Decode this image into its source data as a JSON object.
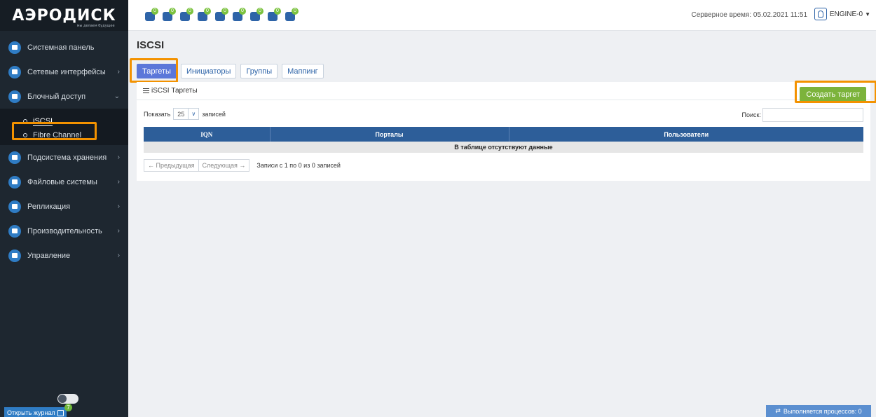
{
  "app": {
    "logo": "АЭРОДИСК",
    "logo_tagline": "мы делаем будущее"
  },
  "sidebar": {
    "items": [
      {
        "label": "Системная панель",
        "icon": "dashboard-icon",
        "arrow": ""
      },
      {
        "label": "Сетевые интерфейсы",
        "icon": "network-icon",
        "arrow": "›"
      },
      {
        "label": "Блочный доступ",
        "icon": "block-access-icon",
        "arrow": "⌄"
      },
      {
        "label": "Подсистема хранения",
        "icon": "storage-icon",
        "arrow": "›"
      },
      {
        "label": "Файловые системы",
        "icon": "filesystem-icon",
        "arrow": "›"
      },
      {
        "label": "Репликация",
        "icon": "replication-icon",
        "arrow": "›"
      },
      {
        "label": "Производительность",
        "icon": "performance-icon",
        "arrow": "›"
      },
      {
        "label": "Управление",
        "icon": "management-icon",
        "arrow": "›"
      }
    ],
    "block_access_sub": [
      {
        "label": "iSCSI",
        "active": true
      },
      {
        "label": "Fibre Channel",
        "active": false
      }
    ],
    "journal_label": "Открыть журнал",
    "journal_count": "7"
  },
  "topbar": {
    "status_icons": [
      {
        "name": "storage-status-icon",
        "count": "0"
      },
      {
        "name": "controller-status-icon",
        "count": "0"
      },
      {
        "name": "switch-status-icon",
        "count": "0"
      },
      {
        "name": "network-status-icon",
        "count": "0"
      },
      {
        "name": "cpu-status-icon",
        "count": "0"
      },
      {
        "name": "fan-status-icon",
        "count": "0"
      },
      {
        "name": "temperature-status-icon",
        "count": "0"
      },
      {
        "name": "memory-status-icon",
        "count": "0"
      },
      {
        "name": "disk-status-icon",
        "count": "0"
      }
    ],
    "server_time": "Серверное время: 05.02.2021 11:51",
    "user": "ENGINE-0"
  },
  "main": {
    "title": "ISCSI",
    "tabs": [
      {
        "label": "Таргеты",
        "active": true
      },
      {
        "label": "Инициаторы",
        "active": false
      },
      {
        "label": "Группы",
        "active": false
      },
      {
        "label": "Маппинг",
        "active": false
      }
    ],
    "panel_title": "iSCSI Таргеты",
    "create_button": "Создать таргет",
    "show_prefix": "Показать",
    "page_size": "25",
    "show_suffix": "записей",
    "search_label": "Поиск:",
    "search_value": "",
    "table": {
      "columns": [
        "IQN",
        "Порталы",
        "Пользователи"
      ],
      "empty_message": "В таблице отсутствуют данные"
    },
    "prev_label": "← Предыдущая",
    "next_label": "Следующая →",
    "records_info": "Записи с 1 по 0 из 0 записей"
  },
  "footer": {
    "processes": "Выполняется процессов: 0"
  },
  "colors": {
    "sidebar_bg": "#1e2730",
    "accent_blue": "#2d5e99",
    "tab_active": "#5b77d9",
    "create_green": "#7cb33b",
    "highlight_orange": "#f39200"
  }
}
